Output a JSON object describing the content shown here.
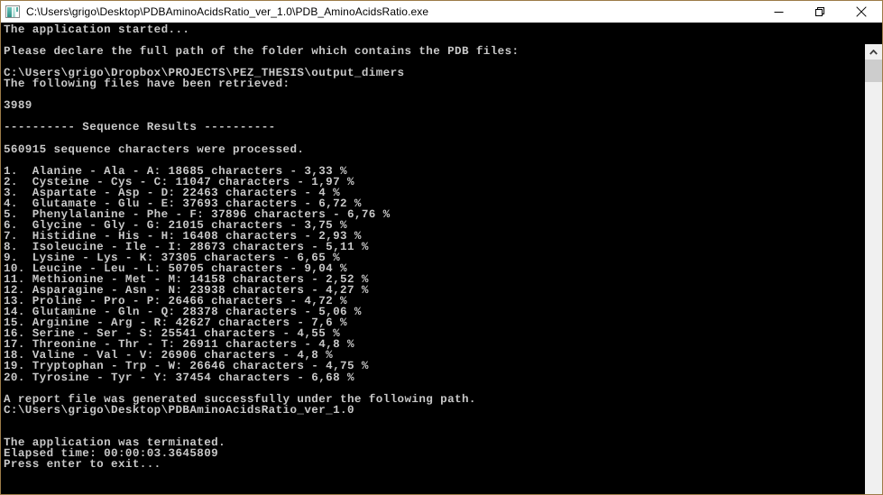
{
  "window": {
    "title": "C:\\Users\\grigo\\Desktop\\PDBAminoAcidsRatio_ver_1.0\\PDB_AminoAcidsRatio.exe",
    "icon": "console-app-icon",
    "border_color": "#9c7b48",
    "titlebar_bg": "#ffffff",
    "console_bg": "#000000",
    "console_fg": "#c8c8c8"
  },
  "controls": {
    "minimize_label": "Minimize",
    "restore_label": "Restore",
    "close_label": "Close"
  },
  "scrollbar": {
    "up_arrow_label": "Scroll up",
    "thumb_label": "Scroll thumb"
  },
  "console": {
    "intro": {
      "started": "The application started...",
      "prompt": "Please declare the full path of the folder which contains the PDB files:",
      "input_path": "C:\\Users\\grigo\\Dropbox\\PROJECTS\\PEZ_THESIS\\output_dimers",
      "retrieved_label": "The following files have been retrieved:",
      "file_count": "3989",
      "section_header": "---------- Sequence Results ----------",
      "processed": "560915 sequence characters were processed."
    },
    "results": [
      "1.  Alanine - Ala - A: 18685 characters - 3,33 %",
      "2.  Cysteine - Cys - C: 11047 characters - 1,97 %",
      "3.  Aspartate - Asp - D: 22463 characters - 4 %",
      "4.  Glutamate - Glu - E: 37693 characters - 6,72 %",
      "5.  Phenylalanine - Phe - F: 37896 characters - 6,76 %",
      "6.  Glycine - Gly - G: 21015 characters - 3,75 %",
      "7.  Histidine - His - H: 16408 characters - 2,93 %",
      "8.  Isoleucine - Ile - I: 28673 characters - 5,11 %",
      "9.  Lysine - Lys - K: 37305 characters - 6,65 %",
      "10. Leucine - Leu - L: 50705 characters - 9,04 %",
      "11. Methionine - Met - M: 14158 characters - 2,52 %",
      "12. Asparagine - Asn - N: 23938 characters - 4,27 %",
      "13. Proline - Pro - P: 26466 characters - 4,72 %",
      "14. Glutamine - Gln - Q: 28378 characters - 5,06 %",
      "15. Arginine - Arg - R: 42627 characters - 7,6 %",
      "16. Serine - Ser - S: 25541 characters - 4,55 %",
      "17. Threonine - Thr - T: 26911 characters - 4,8 %",
      "18. Valine - Val - V: 26906 characters - 4,8 %",
      "19. Tryptophan - Trp - W: 26646 characters - 4,75 %",
      "20. Tyrosine - Tyr - Y: 37454 characters - 6,68 %"
    ],
    "outro": {
      "report_message": "A report file was generated successfully under the following path.",
      "report_path": "C:\\Users\\grigo\\Desktop\\PDBAminoAcidsRatio_ver_1.0",
      "terminated": "The application was terminated.",
      "elapsed": "Elapsed time: 00:00:03.3645809",
      "exit_prompt": "Press enter to exit..."
    }
  }
}
